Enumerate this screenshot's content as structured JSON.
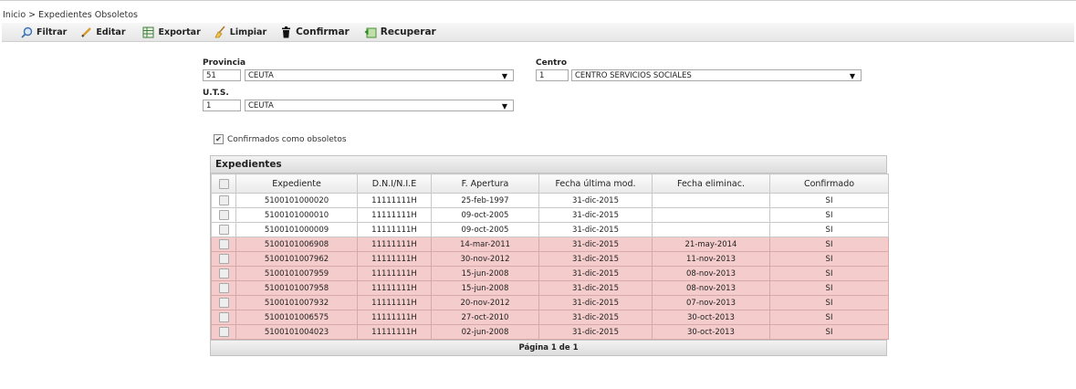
{
  "breadcrumb": {
    "home": "Inicio",
    "separator": ">",
    "current": "Expedientes Obsoletos"
  },
  "toolbar": {
    "filtrar": "Filtrar",
    "editar": "Editar",
    "exportar": "Exportar",
    "limpiar": "Limpiar",
    "confirmar": "Confirmar",
    "recuperar": "Recuperar"
  },
  "form": {
    "provincia": {
      "label": "Provincia",
      "code": "51",
      "value": "CEUTA"
    },
    "centro": {
      "label": "Centro",
      "code": "1",
      "value": "CENTRO SERVICIOS SOCIALES"
    },
    "uts": {
      "label": "U.T.S.",
      "code": "1",
      "value": "CEUTA"
    },
    "confirmados": {
      "label": "Confirmados como obsoletos",
      "checked": true
    }
  },
  "grid": {
    "caption": "Expedientes",
    "columns": [
      "Expediente",
      "D.N.I/N.I.E",
      "F. Apertura",
      "Fecha última mod.",
      "Fecha eliminac.",
      "Confirmado"
    ],
    "rows": [
      {
        "expediente": "5100101000020",
        "dni": "11111111H",
        "apertura": "25-feb-1997",
        "ultima": "31-dic-2015",
        "eliminac": "",
        "confirmado": "SI",
        "highlight": false
      },
      {
        "expediente": "5100101000010",
        "dni": "11111111H",
        "apertura": "09-oct-2005",
        "ultima": "31-dic-2015",
        "eliminac": "",
        "confirmado": "SI",
        "highlight": false
      },
      {
        "expediente": "5100101000009",
        "dni": "11111111H",
        "apertura": "09-oct-2005",
        "ultima": "31-dic-2015",
        "eliminac": "",
        "confirmado": "SI",
        "highlight": false
      },
      {
        "expediente": "5100101006908",
        "dni": "11111111H",
        "apertura": "14-mar-2011",
        "ultima": "31-dic-2015",
        "eliminac": "21-may-2014",
        "confirmado": "SI",
        "highlight": true
      },
      {
        "expediente": "5100101007962",
        "dni": "11111111H",
        "apertura": "30-nov-2012",
        "ultima": "31-dic-2015",
        "eliminac": "11-nov-2013",
        "confirmado": "SI",
        "highlight": true
      },
      {
        "expediente": "5100101007959",
        "dni": "11111111H",
        "apertura": "15-jun-2008",
        "ultima": "31-dic-2015",
        "eliminac": "08-nov-2013",
        "confirmado": "SI",
        "highlight": true
      },
      {
        "expediente": "5100101007958",
        "dni": "11111111H",
        "apertura": "15-jun-2008",
        "ultima": "31-dic-2015",
        "eliminac": "08-nov-2013",
        "confirmado": "SI",
        "highlight": true
      },
      {
        "expediente": "5100101007932",
        "dni": "11111111H",
        "apertura": "20-nov-2012",
        "ultima": "31-dic-2015",
        "eliminac": "07-nov-2013",
        "confirmado": "SI",
        "highlight": true
      },
      {
        "expediente": "5100101006575",
        "dni": "11111111H",
        "apertura": "27-oct-2010",
        "ultima": "31-dic-2015",
        "eliminac": "30-oct-2013",
        "confirmado": "SI",
        "highlight": true
      },
      {
        "expediente": "5100101004023",
        "dni": "11111111H",
        "apertura": "02-jun-2008",
        "ultima": "31-dic-2015",
        "eliminac": "30-oct-2013",
        "confirmado": "SI",
        "highlight": true
      }
    ],
    "pager": "Página 1 de 1"
  },
  "colors": {
    "highlight_row": "#f4cccc",
    "toolbar_bg": "#eeeeee"
  }
}
